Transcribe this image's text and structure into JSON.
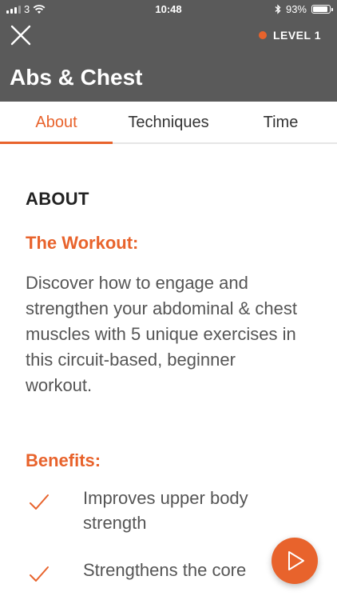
{
  "status_bar": {
    "carrier": "3",
    "time": "10:48",
    "battery": "93%",
    "battery_level": 0.93
  },
  "header": {
    "level_label": "LEVEL 1",
    "title": "Abs & Chest",
    "accent_color": "#e8632c",
    "background_color": "#5a5a5a"
  },
  "tabs": [
    {
      "label": "About",
      "active": true
    },
    {
      "label": "Techniques",
      "active": false
    },
    {
      "label": "Time",
      "active": false
    }
  ],
  "about": {
    "heading": "ABOUT",
    "workout_heading": "The Workout:",
    "workout_description": "Discover how to engage and strengthen your abdominal & chest muscles with 5 unique exercises in this circuit-based, beginner workout.",
    "benefits_heading": "Benefits:",
    "benefits": [
      "Improves upper body strength",
      "Strengthens the core"
    ]
  },
  "icons": {
    "close": "close-icon",
    "check": "check-icon",
    "play": "play-icon",
    "wifi": "wifi-icon",
    "bluetooth": "bluetooth-icon"
  }
}
